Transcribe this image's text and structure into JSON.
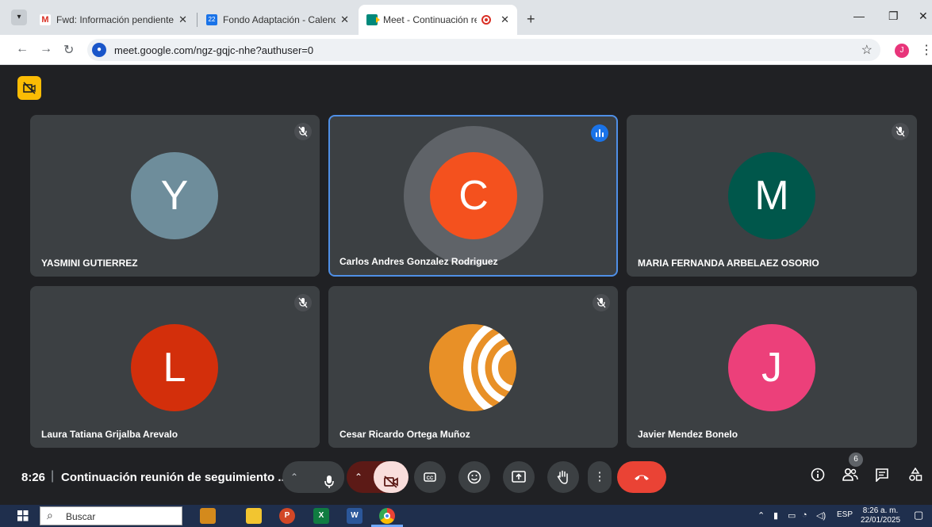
{
  "browser": {
    "tabs": [
      {
        "title": "Fwd: Información pendiente de",
        "favicon": "gmail-icon",
        "active": false
      },
      {
        "title": "Fondo Adaptación - Calendar -",
        "favicon": "calendar-icon",
        "calendar_day": "22",
        "active": false
      },
      {
        "title": "Meet - Continuación reunió",
        "favicon": "meet-icon",
        "active": true,
        "recording": true
      }
    ],
    "url": "meet.google.com/ngz-gqjc-nhe?authuser=0",
    "profile_initial": "J"
  },
  "meet": {
    "participants": [
      {
        "name": "YASMINI GUTIERREZ",
        "initial": "Y",
        "color": "#6e8d9b",
        "muted": true,
        "speaking": false
      },
      {
        "name": "Carlos Andres Gonzalez Rodriguez",
        "initial": "C",
        "color": "#f4511e",
        "muted": false,
        "speaking": true
      },
      {
        "name": "MARIA FERNANDA ARBELAEZ OSORIO",
        "initial": "M",
        "color": "#00574b",
        "muted": true,
        "speaking": false
      },
      {
        "name": "Laura Tatiana Grijalba Arevalo",
        "initial": "L",
        "color": "#d32f0b",
        "muted": true,
        "speaking": false
      },
      {
        "name": "Cesar Ricardo Ortega Muñoz",
        "initial": "",
        "color": "#e89027",
        "muted": true,
        "speaking": false,
        "photo": "orange-logo-avatar"
      },
      {
        "name": "Javier Mendez Bonelo",
        "initial": "J",
        "color": "#ec407a",
        "muted": false,
        "speaking": false
      }
    ],
    "controls": {
      "time": "8:26",
      "separator": "|",
      "meeting_title": "Continuación reunión de seguimiento ...",
      "people_count": "6"
    }
  },
  "taskbar": {
    "search_placeholder": "Buscar",
    "language": "ESP",
    "clock_time": "8:26 a. m.",
    "clock_date": "22/01/2025"
  },
  "colors": {
    "meet_background": "#202124",
    "tile_background": "#3c4043",
    "end_call": "#ea4335",
    "camera_off": "#f9dedc",
    "speaking_border": "#4f8fe6"
  }
}
